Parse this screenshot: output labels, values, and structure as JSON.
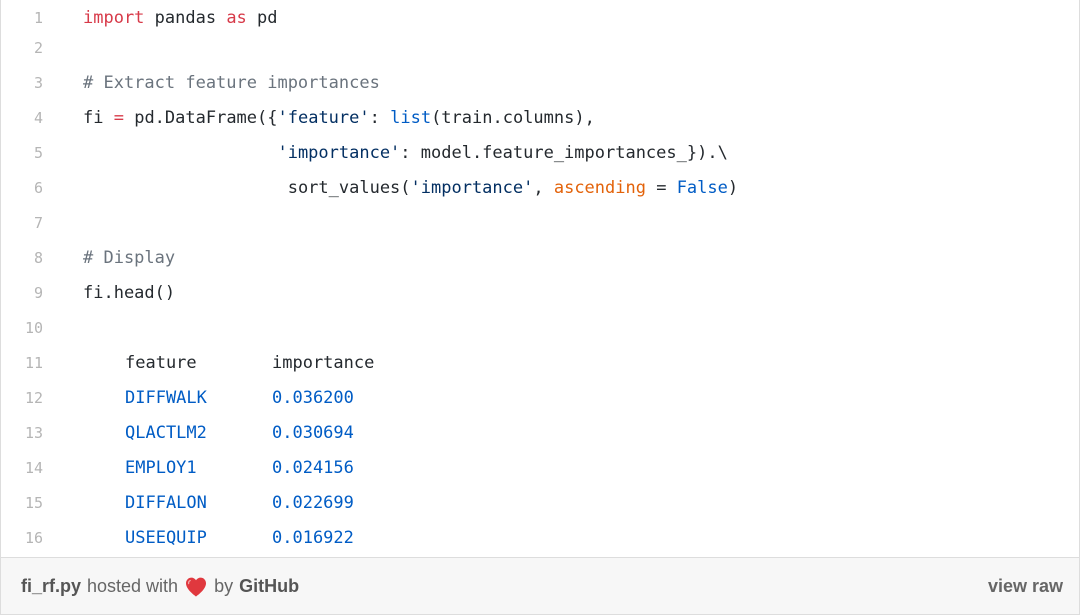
{
  "code": {
    "line_numbers": [
      "1",
      "2",
      "3",
      "4",
      "5",
      "6",
      "7",
      "8",
      "9",
      "10",
      "11",
      "12",
      "13",
      "14",
      "15",
      "16"
    ],
    "l1": {
      "kw_import": "import",
      "mod": " pandas ",
      "kw_as": "as",
      "alias": " pd"
    },
    "l3": {
      "comment": "# Extract feature importances"
    },
    "l4": {
      "var": "fi ",
      "eq": "=",
      "call": " pd.DataFrame({",
      "key1": "'feature'",
      "colon": ": ",
      "list_fn": "list",
      "args": "(train.columns),"
    },
    "l5": {
      "indent": "                   ",
      "key2": "'importance'",
      "rest": ": model.feature_importances_}).\\"
    },
    "l6": {
      "indent": "                    ",
      "call": "sort_values(",
      "arg": "'importance'",
      "comma": ", ",
      "param": "ascending",
      "eq": " = ",
      "val": "False",
      "close": ")"
    },
    "l8": {
      "comment": "# Display"
    },
    "l9": {
      "text": "fi.head()"
    },
    "table": {
      "headers": [
        "feature",
        "importance"
      ],
      "rows": [
        {
          "feature": "DIFFWALK",
          "importance": "0.036200"
        },
        {
          "feature": "QLACTLM2",
          "importance": "0.030694"
        },
        {
          "feature": "EMPLOY1",
          "importance": "0.024156"
        },
        {
          "feature": "DIFFALON",
          "importance": "0.022699"
        },
        {
          "feature": "USEEQUIP",
          "importance": "0.016922"
        }
      ]
    }
  },
  "footer": {
    "filename": "fi_rf.py",
    "hosted_with": "hosted with",
    "by": "by",
    "host": "GitHub",
    "view_raw": "view raw",
    "heart_color": "#e0383e"
  }
}
